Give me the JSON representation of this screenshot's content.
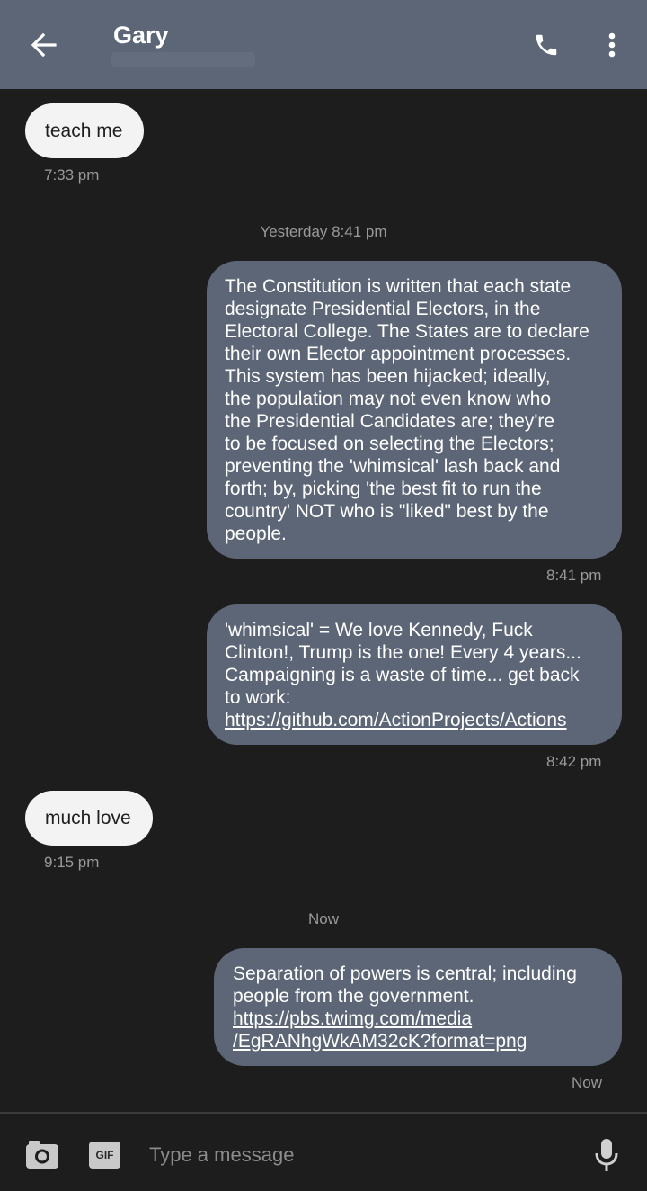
{
  "header": {
    "contact_name": "Gary"
  },
  "messages": [
    {
      "direction": "in",
      "text": "teach me",
      "time": "7:33 pm"
    },
    {
      "direction": "out",
      "lines": [
        "The Constitution is written that each state",
        "designate Presidential Electors, in the",
        "Electoral College. The States are to declare",
        "their own Elector appointment processes.",
        "This system has been hijacked; ideally,",
        "the population may not even know who",
        "the Presidential Candidates are; they're",
        "to be focused on selecting the Electors;",
        "preventing the 'whimsical' lash back and",
        "forth; by, picking 'the best fit to run the",
        "country' NOT who is \"liked\" best by the",
        "people."
      ],
      "time": "8:41 pm"
    },
    {
      "direction": "out",
      "lines": [
        "'whimsical' = We love Kennedy, Fuck",
        "Clinton!, Trump is the one! Every 4 years...",
        "Campaigning is a waste of time... get back",
        "to work:"
      ],
      "link": "https://github.com/ActionProjects/Actions",
      "time": "8:42 pm"
    },
    {
      "direction": "in",
      "text": "much love",
      "time": "9:15 pm"
    },
    {
      "direction": "out",
      "lines": [
        "Separation of powers is central; including",
        "people from the government."
      ],
      "link_lines": [
        "https://pbs.twimg.com/media",
        "/EgRANhgWkAM32cK?format=png"
      ],
      "time": "Now"
    }
  ],
  "dividers": [
    "Yesterday 8:41 pm",
    "Now"
  ],
  "composer": {
    "gif_label": "GIF",
    "placeholder": "Type a message"
  },
  "colors": {
    "app_bar": "#5d6676",
    "background": "#1d1d1e",
    "outgoing_bubble": "#5d6676",
    "incoming_bubble": "#f3f3f3"
  },
  "icons": [
    "back-arrow-icon",
    "phone-icon",
    "more-vert-icon",
    "camera-icon",
    "microphone-icon"
  ]
}
